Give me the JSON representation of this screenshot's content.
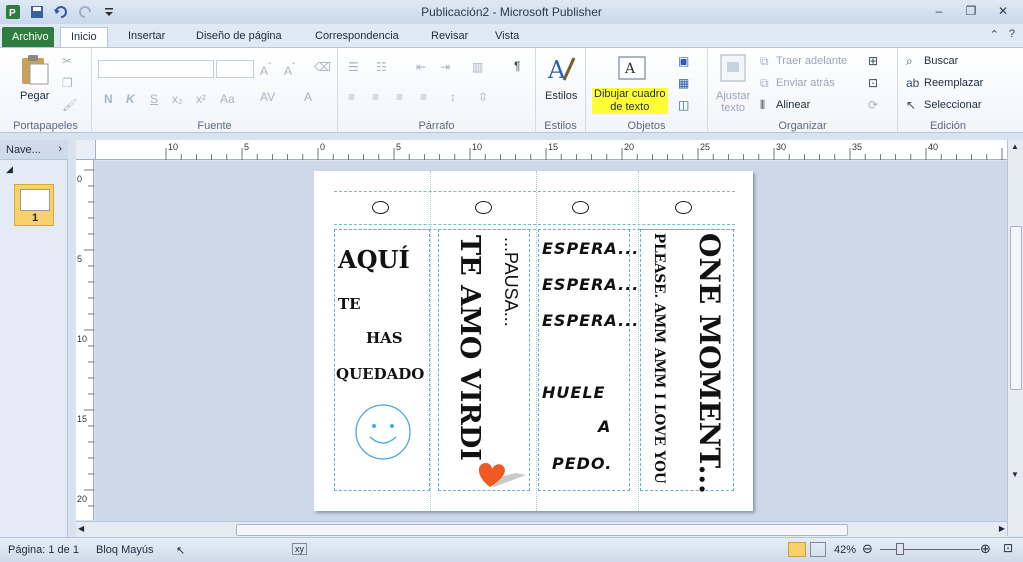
{
  "window": {
    "title": "Publicación2 - Microsoft Publisher"
  },
  "tabs": [
    "Archivo",
    "Inicio",
    "Insertar",
    "Diseño de página",
    "Correspondencia",
    "Revisar",
    "Vista"
  ],
  "ribbon": {
    "clipboard": {
      "paste": "Pegar",
      "label": "Portapapeles"
    },
    "font": {
      "label": "Fuente",
      "name_value": "",
      "size_value": ""
    },
    "paragraph": {
      "label": "Párrafo"
    },
    "styles": {
      "button": "Estilos",
      "label": "Estilos"
    },
    "objects": {
      "draw_textbox_l1": "Dibujar cuadro",
      "draw_textbox_l2": "de texto",
      "label": "Objetos"
    },
    "arrange": {
      "wrap_l1": "Ajustar",
      "wrap_l2": "texto",
      "bring_forward": "Traer adelante",
      "send_backward": "Enviar atrás",
      "align": "Alinear",
      "label": "Organizar"
    },
    "editing": {
      "find": "Buscar",
      "replace": "Reemplazar",
      "select": "Seleccionar",
      "label": "Edición"
    }
  },
  "nav": {
    "title": "Nave...",
    "page_number": "1"
  },
  "ruler": {
    "h": [
      "10",
      "5",
      "0",
      "5",
      "10",
      "15",
      "20",
      "25",
      "30",
      "35",
      "40"
    ],
    "v": [
      "0",
      "5",
      "10",
      "15",
      "20"
    ]
  },
  "page": {
    "col1": {
      "l1": "AQUÍ",
      "l2": "TE",
      "l3": "HAS",
      "l4": "QUEDADO"
    },
    "col2": {
      "main": "TE AMO VIRDI",
      "side": "...PAUSA..."
    },
    "col3": {
      "l1": "ESPERA...",
      "l2": "ESPERA...",
      "l3": "ESPERA...",
      "l4": "HUELE",
      "l5": "A",
      "l6": "PEDO."
    },
    "col4": {
      "main": "ONE MOMENT...",
      "side": "PLEASE. AMM AMM I LOVE YOU"
    }
  },
  "status": {
    "page": "Página: 1 de 1",
    "caps": "Bloq Mayús",
    "zoom": "42%"
  },
  "colors": {
    "file_tab": "#2f7d3e",
    "highlight": "#ffff33",
    "guides": "#6aaecb",
    "heart": "#f05a22",
    "smiley": "#4aa8d8"
  }
}
